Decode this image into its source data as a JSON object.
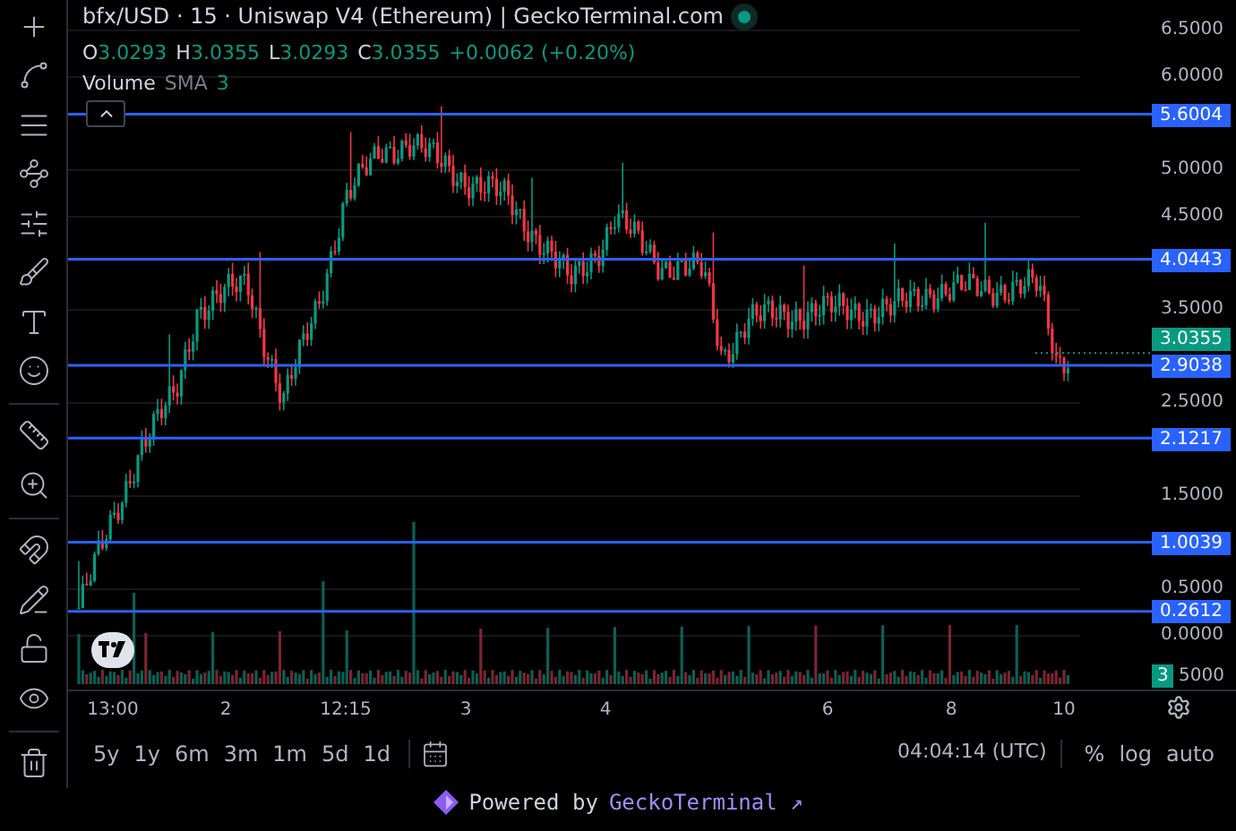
{
  "title": "bfx/USD · 15 · Uniswap V4 (Ethereum) | GeckoTerminal.com",
  "ohlc": [
    {
      "label": "O",
      "value": "3.0293"
    },
    {
      "label": "H",
      "value": "3.0355"
    },
    {
      "label": "L",
      "value": "3.0293"
    },
    {
      "label": "C",
      "value": "3.0355"
    }
  ],
  "change": "+0.0062 (+0.20%)",
  "volume_legend": {
    "label": "Volume",
    "indicator": "SMA",
    "value": "3"
  },
  "price_ticks": [
    "6.5000",
    "6.0000",
    "5.0000",
    "4.5000",
    "3.5000",
    "2.5000",
    "1.5000",
    "0.5000",
    "0.0000"
  ],
  "price_lines": [
    {
      "value": "5.6004"
    },
    {
      "value": "4.0443"
    },
    {
      "value": "2.9038"
    },
    {
      "value": "2.1217"
    },
    {
      "value": "1.0039"
    },
    {
      "value": "0.2612"
    }
  ],
  "current_price": "3.0355",
  "volume_axis": {
    "tick": "5000",
    "current": "3"
  },
  "time_axis": [
    "13:00",
    "2",
    "12:15",
    "3",
    "4",
    "6",
    "8",
    "10"
  ],
  "ranges": [
    "5y",
    "1y",
    "6m",
    "3m",
    "1m",
    "5d",
    "1d"
  ],
  "clock": "04:04:14 (UTC)",
  "scale_options": [
    "%",
    "log",
    "auto"
  ],
  "footer": {
    "prefix": "Powered by",
    "link": "GeckoTerminal ↗"
  }
}
